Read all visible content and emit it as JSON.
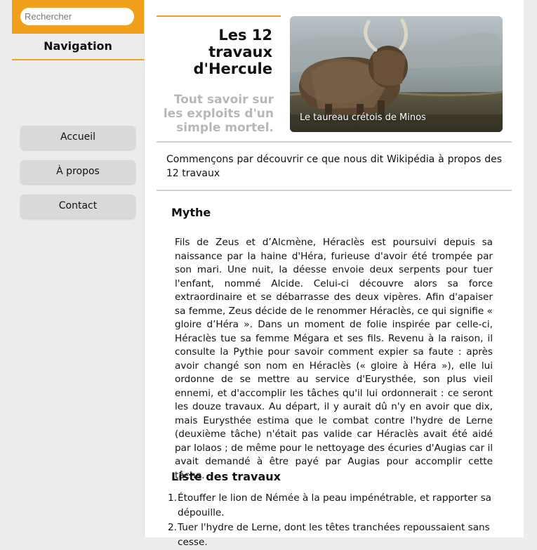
{
  "search": {
    "placeholder": "Rechercher"
  },
  "nav": {
    "title": "Navigation",
    "items": [
      {
        "label": "Accueil"
      },
      {
        "label": "À propos"
      },
      {
        "label": "Contact"
      }
    ]
  },
  "header": {
    "title": "Les 12 travaux d'Hercule",
    "subtitle": "Tout savoir sur les exploits d'un simple mortel."
  },
  "hero": {
    "caption": "Le taureau crétois de Minos"
  },
  "intro": "Commençons par découvrir ce que nous dit Wikipédia à propos des 12 travaux",
  "myth": {
    "heading": "Mythe",
    "text": "Fils de Zeus et d’Alcmène, Héraclès est poursuivi depuis sa naissance par la haine d'Héra, furieuse d'avoir été trompée par son mari. Une nuit, la déesse envoie deux serpents pour tuer l'enfant, nommé Alcide. Celui-ci découvre alors sa force extraordinaire et se débarrasse des deux vipères. Afin d'apaiser sa femme, Zeus décide de le renommer Héraclès, ce qui signifie « gloire d’Héra ». Dans un moment de folie inspirée par celle-ci, Héraclès tue sa femme Mégara et ses fils. Revenu à la raison, il consulte la Pythie pour savoir comment expier sa faute : après avoir changé son nom en Héraclès (« gloire à Héra »), elle lui ordonne de se mettre au service d'Eurysthée, son plus vieil ennemi, et d'accomplir les tâches qu'il lui ordonnerait : ce seront les douze travaux. Au départ, il y aurait dû n'y en avoir que dix, mais Eurysthée estima que le combat contre l'hydre de Lerne (deuxième tâche) n'était pas valide car Héraclès avait été aidé par Iolaos ; de même pour le nettoyage des écuries d'Augias car il avait demandé à être payé par Augias pour accomplir cette tâche."
  },
  "tasks": {
    "heading": "Liste des travaux",
    "items": [
      {
        "num": "1.",
        "text": "Étouffer le lion de Némée à la peau impénétrable, et rapporter sa dépouille."
      },
      {
        "num": "2.",
        "text": "Tuer l'hydre de Lerne, dont les têtes tranchées repoussaient sans cesse."
      }
    ]
  },
  "colors": {
    "accent": "#f0a01c",
    "sidebar_bg": "#ececec",
    "button_bg": "#d9d9d9",
    "subtitle": "#b7b7b7"
  }
}
